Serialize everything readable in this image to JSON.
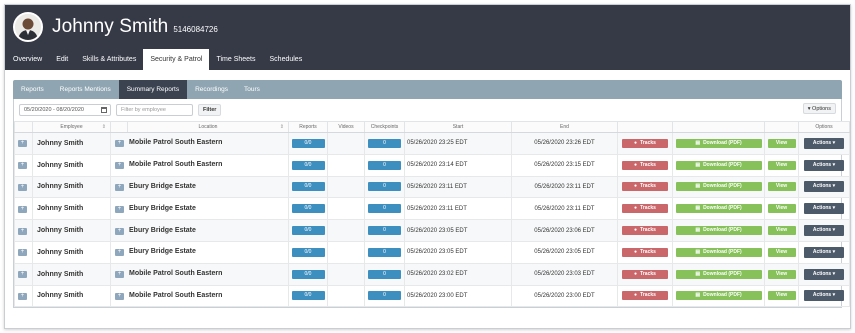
{
  "header": {
    "user_name": "Johnny Smith",
    "user_id": "5146084726",
    "avatar_icon": "user-avatar-icon"
  },
  "nav_tabs": [
    {
      "label": "Overview",
      "active": false
    },
    {
      "label": "Edit",
      "active": false
    },
    {
      "label": "Skills & Attributes",
      "active": false
    },
    {
      "label": "Security & Patrol",
      "active": true
    },
    {
      "label": "Time Sheets",
      "active": false
    },
    {
      "label": "Schedules",
      "active": false
    }
  ],
  "sub_tabs": [
    {
      "label": "Reports",
      "active": false
    },
    {
      "label": "Reports Mentions",
      "active": false
    },
    {
      "label": "Summary Reports",
      "active": true
    },
    {
      "label": "Recordings",
      "active": false
    },
    {
      "label": "Tours",
      "active": false
    }
  ],
  "filters": {
    "date_range": "05/20/2020 - 08/20/2020",
    "employee_placeholder": "Filter by employee",
    "filter_label": "Filter",
    "options_label": "▾ Options"
  },
  "table": {
    "columns": [
      "",
      "Employee",
      "",
      "Location",
      "Reports",
      "Videos",
      "Checkpoints",
      "Start",
      "End",
      "",
      "",
      "",
      "Options"
    ],
    "buttons": {
      "tracks": "Tracks",
      "download": "Download (PDF)",
      "view": "View",
      "actions": "Actions ▾"
    },
    "rows": [
      {
        "employee": "Johnny Smith",
        "location": "Mobile Patrol South Eastern",
        "reports": "0/0",
        "videos": "",
        "checkpoints": "0",
        "start": "05/26/2020 23:25 EDT",
        "end": "05/26/2020 23:26 EDT"
      },
      {
        "employee": "Johnny Smith",
        "location": "Mobile Patrol South Eastern",
        "reports": "0/0",
        "videos": "",
        "checkpoints": "0",
        "start": "05/26/2020 23:14 EDT",
        "end": "05/26/2020 23:15 EDT"
      },
      {
        "employee": "Johnny Smith",
        "location": "Ebury Bridge Estate",
        "reports": "0/0",
        "videos": "",
        "checkpoints": "0",
        "start": "05/26/2020 23:11 EDT",
        "end": "05/26/2020 23:11 EDT"
      },
      {
        "employee": "Johnny Smith",
        "location": "Ebury Bridge Estate",
        "reports": "0/0",
        "videos": "",
        "checkpoints": "0",
        "start": "05/26/2020 23:11 EDT",
        "end": "05/26/2020 23:11 EDT"
      },
      {
        "employee": "Johnny Smith",
        "location": "Ebury Bridge Estate",
        "reports": "0/0",
        "videos": "",
        "checkpoints": "0",
        "start": "05/26/2020 23:05 EDT",
        "end": "05/26/2020 23:06 EDT"
      },
      {
        "employee": "Johnny Smith",
        "location": "Ebury Bridge Estate",
        "reports": "0/0",
        "videos": "",
        "checkpoints": "0",
        "start": "05/26/2020 23:05 EDT",
        "end": "05/26/2020 23:05 EDT"
      },
      {
        "employee": "Johnny Smith",
        "location": "Mobile Patrol South Eastern",
        "reports": "0/0",
        "videos": "",
        "checkpoints": "0",
        "start": "05/26/2020 23:02 EDT",
        "end": "05/26/2020 23:03 EDT"
      },
      {
        "employee": "Johnny Smith",
        "location": "Mobile Patrol South Eastern",
        "reports": "0/0",
        "videos": "",
        "checkpoints": "0",
        "start": "05/26/2020 23:00 EDT",
        "end": "05/26/2020 23:00 EDT"
      }
    ]
  }
}
